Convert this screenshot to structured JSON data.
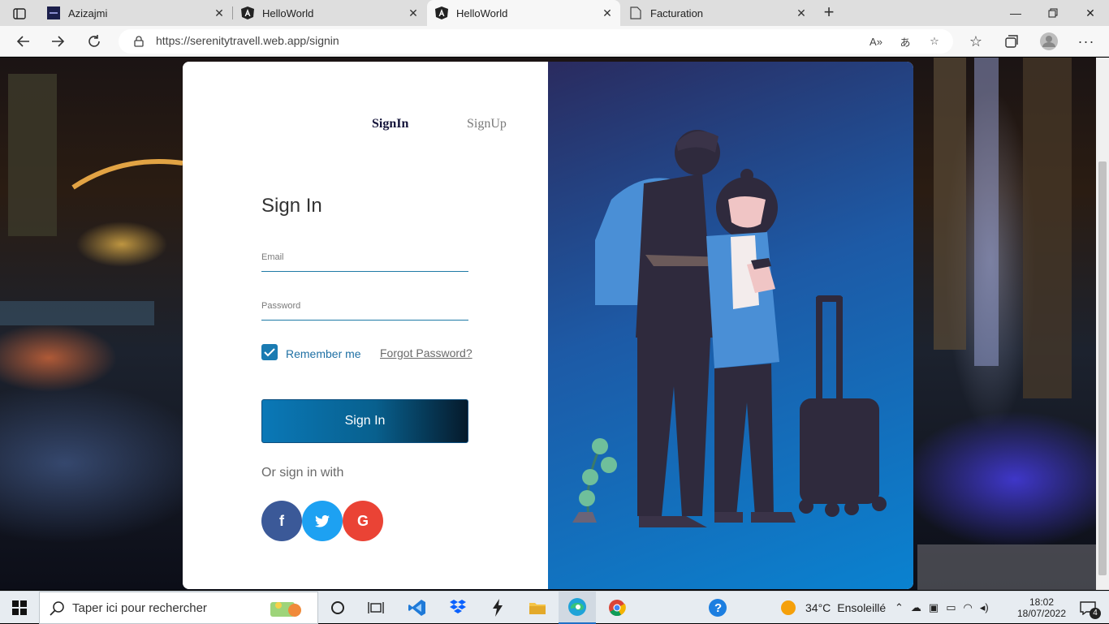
{
  "browser": {
    "tabs": [
      {
        "title": "Azizajmi"
      },
      {
        "title": "HelloWorld"
      },
      {
        "title": "HelloWorld"
      },
      {
        "title": "Facturation"
      }
    ],
    "url": "https://serenitytravell.web.app/signin"
  },
  "page": {
    "tab_signin": "SignIn",
    "tab_signup": "SignUp",
    "heading": "Sign In",
    "email_label": "Email",
    "password_label": "Password",
    "remember_label": "Remember me",
    "remember_checked": true,
    "forgot_label": "Forgot Password?",
    "submit_label": "Sign In",
    "or_text": "Or sign in with",
    "social": [
      {
        "label": "f",
        "icon": "facebook-icon",
        "color": "#3b5998"
      },
      {
        "label": "t",
        "icon": "twitter-icon",
        "color": "#1da1f2"
      },
      {
        "label": "G",
        "icon": "google-icon",
        "color": "#ea4335"
      }
    ]
  },
  "taskbar": {
    "search_placeholder": "Taper ici pour rechercher",
    "weather_temp": "34°C",
    "weather_text": "Ensoleillé",
    "time": "18:02",
    "date": "18/07/2022",
    "notification_count": "4"
  }
}
